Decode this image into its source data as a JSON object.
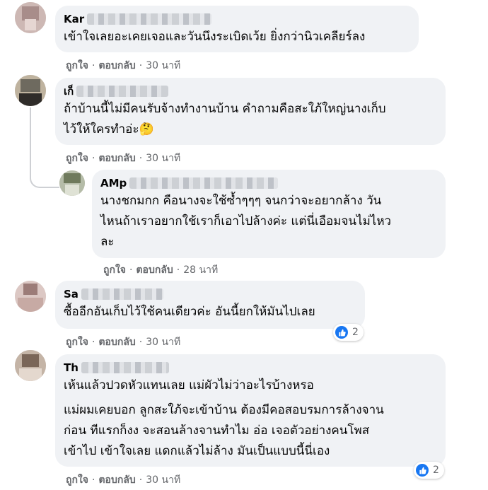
{
  "comments": [
    {
      "name": "Kar",
      "lines": [
        "เข้าใจเลยอะเคยเจอและวันนึงระเบิดเว้ย ยิ่งกว่านิวเคลียร์ลง"
      ],
      "like": "ถูกใจ",
      "reply": "ตอบกลับ",
      "time": "30 นาที"
    },
    {
      "name": "เก็",
      "lines": [
        "ถ้าบ้านนี้ไม่มีคนรับจ้างทำงานบ้าน คำถามคือสะใภ้ใหญ่นางเก็บ",
        "ไว้ให้ใครทำอ่ะ🤔"
      ],
      "like": "ถูกใจ",
      "reply": "ตอบกลับ",
      "time": "30 นาที"
    },
    {
      "name": "AMp",
      "lines": [
        "นางชกมกก คือนางจะใช้ซ้ำๆๆๆ จนกว่าจะอยากล้าง วัน",
        "ไหนถ้าเราอยากใช้เราก็เอาไปล้างค่ะ แต่นี่เอือมจนไม่ไหว",
        "ละ"
      ],
      "like": "ถูกใจ",
      "reply": "ตอบกลับ",
      "time": "28 นาที"
    },
    {
      "name": "Sa",
      "lines": [
        "ซื้ออีกอันเก็บไว้ใช้คนเดียวค่ะ อันนี้ยกให้มันไปเลย"
      ],
      "like": "ถูกใจ",
      "reply": "ตอบกลับ",
      "time": "30 นาที",
      "reaction_count": "2"
    },
    {
      "name": "Th",
      "lines": [
        "เห้นแล้วปวดหัวแทนเลย แม่ผัวไม่ว่าอะไรบ้างหรอ"
      ],
      "lines2": [
        "แม่ผมเคยบอก ลูกสะใภ้จะเข้าบ้าน ต้องมีคอสอบรมการล้างจาน",
        "ก่อน ทีแรกก็งง จะสอนล้างจานทำไม อ่อ เจอตัวอย่างคนโพส",
        "เข้าไป เข้าใจเลย แดกแล้วไม่ล้าง มันเป็นแบบนี้นี่เอง"
      ],
      "like": "ถูกใจ",
      "reply": "ตอบกลับ",
      "time": "30 นาที",
      "reaction_count": "2"
    }
  ],
  "colors": {
    "bubble": "#f0f2f5",
    "meta": "#65676b",
    "like_blue": "#1877f2"
  },
  "icons": {
    "reaction": "thumbs-up-icon"
  }
}
